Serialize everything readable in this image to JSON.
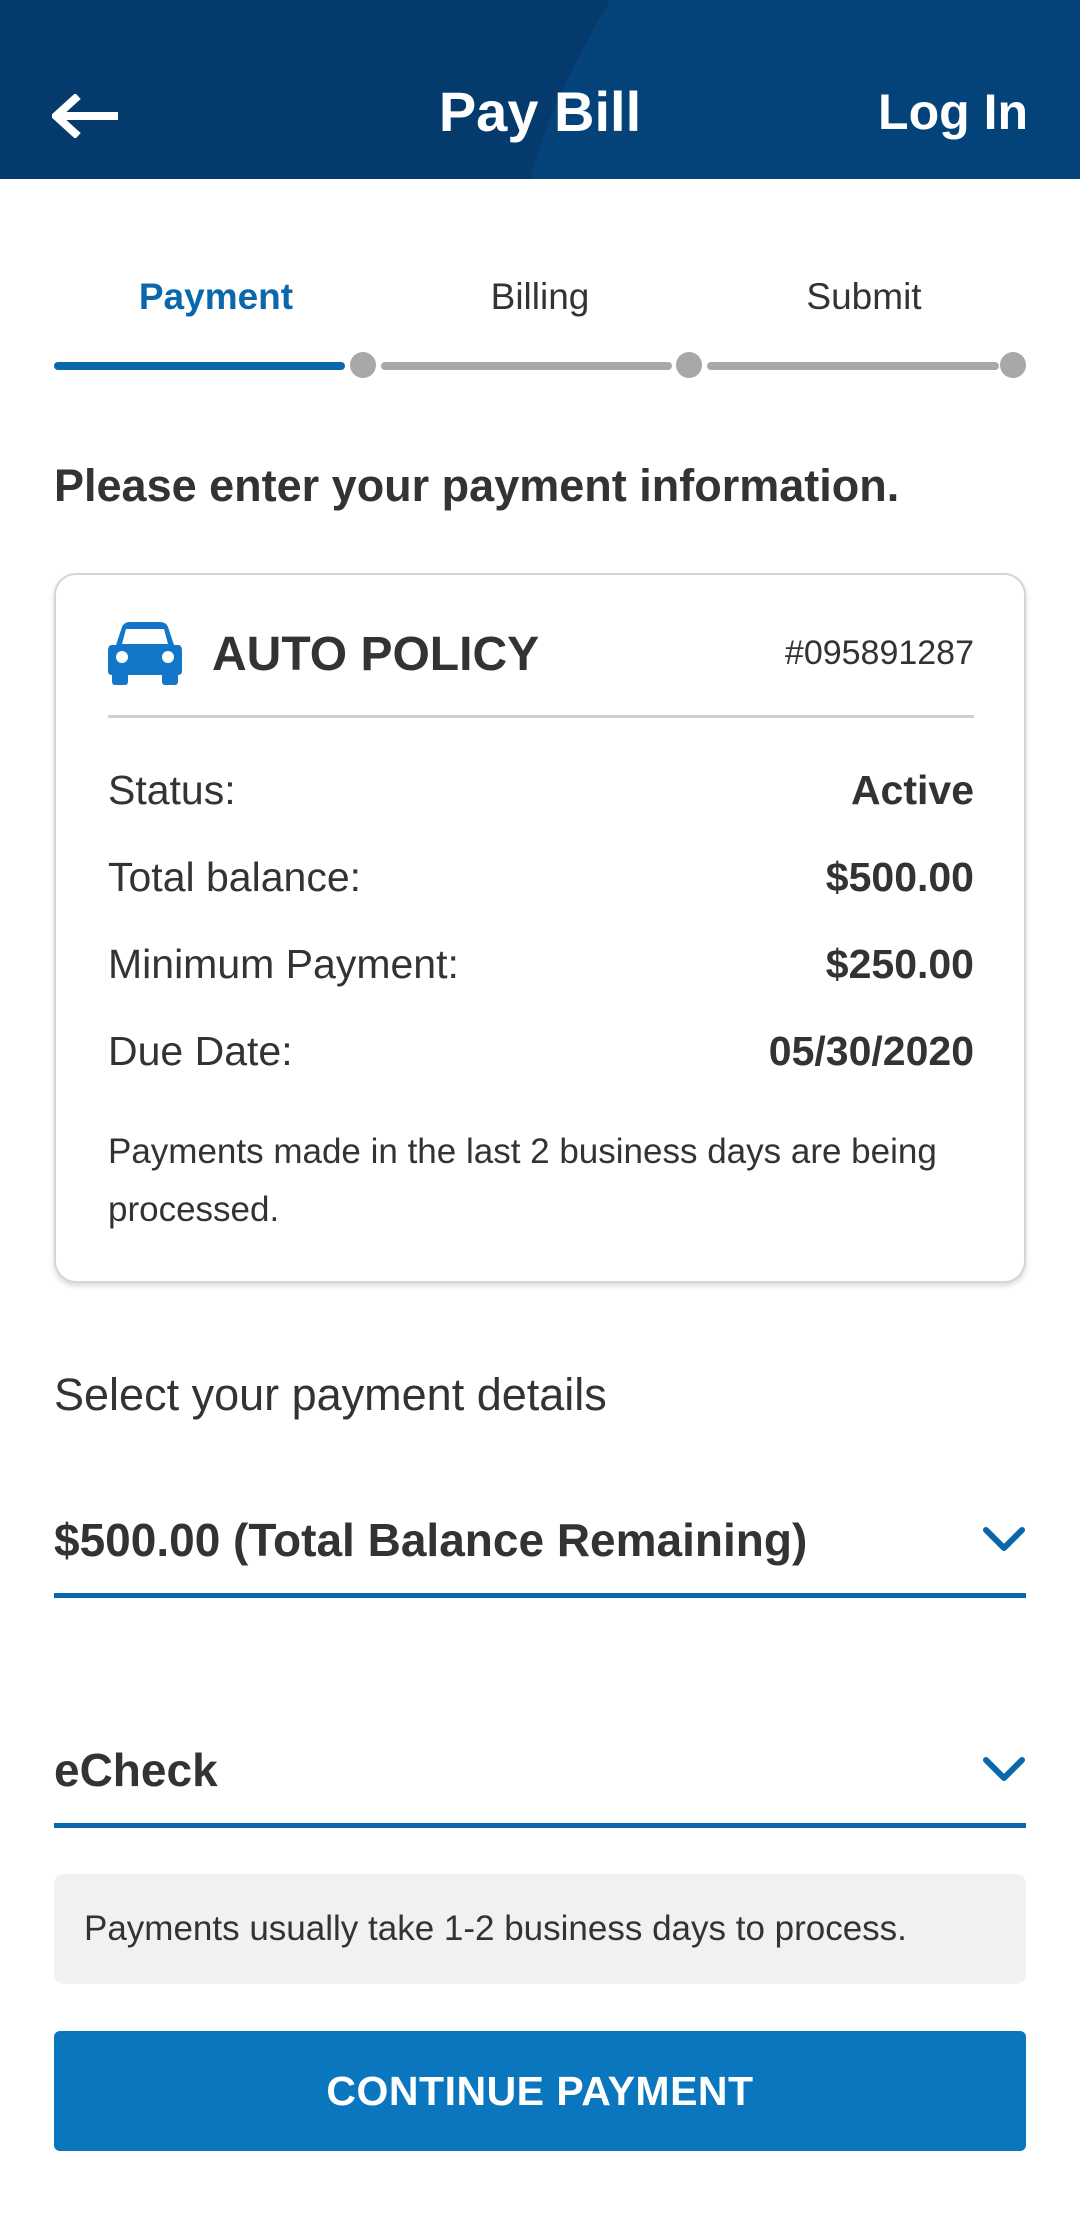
{
  "header": {
    "title": "Pay Bill",
    "login_label": "Log In",
    "back_icon": "arrow-left-icon",
    "bg_color": "#04427a"
  },
  "steps": [
    {
      "label": "Payment",
      "active": true
    },
    {
      "label": "Billing",
      "active": false
    },
    {
      "label": "Submit",
      "active": false
    }
  ],
  "prompt": "Please enter your payment information.",
  "policy": {
    "icon": "car-icon",
    "name": "AUTO POLICY",
    "number": "#095891287",
    "rows": [
      {
        "label": "Status:",
        "value": "Active"
      },
      {
        "label": "Total balance:",
        "value": "$500.00"
      },
      {
        "label": "Minimum Payment:",
        "value": "$250.00"
      },
      {
        "label": "Due Date:",
        "value": "05/30/2020"
      }
    ],
    "note": "Payments made in the last 2 business days are being processed."
  },
  "payment_details": {
    "label": "Select your payment details",
    "amount_select": "$500.00 (Total Balance Remaining)",
    "method_select": "eCheck",
    "info": "Payments usually take 1-2 business days to process."
  },
  "cta_label": "CONTINUE PAYMENT",
  "colors": {
    "accent": "#0a67ac",
    "button": "#0a76bd",
    "inactive": "#a8a8a8"
  }
}
